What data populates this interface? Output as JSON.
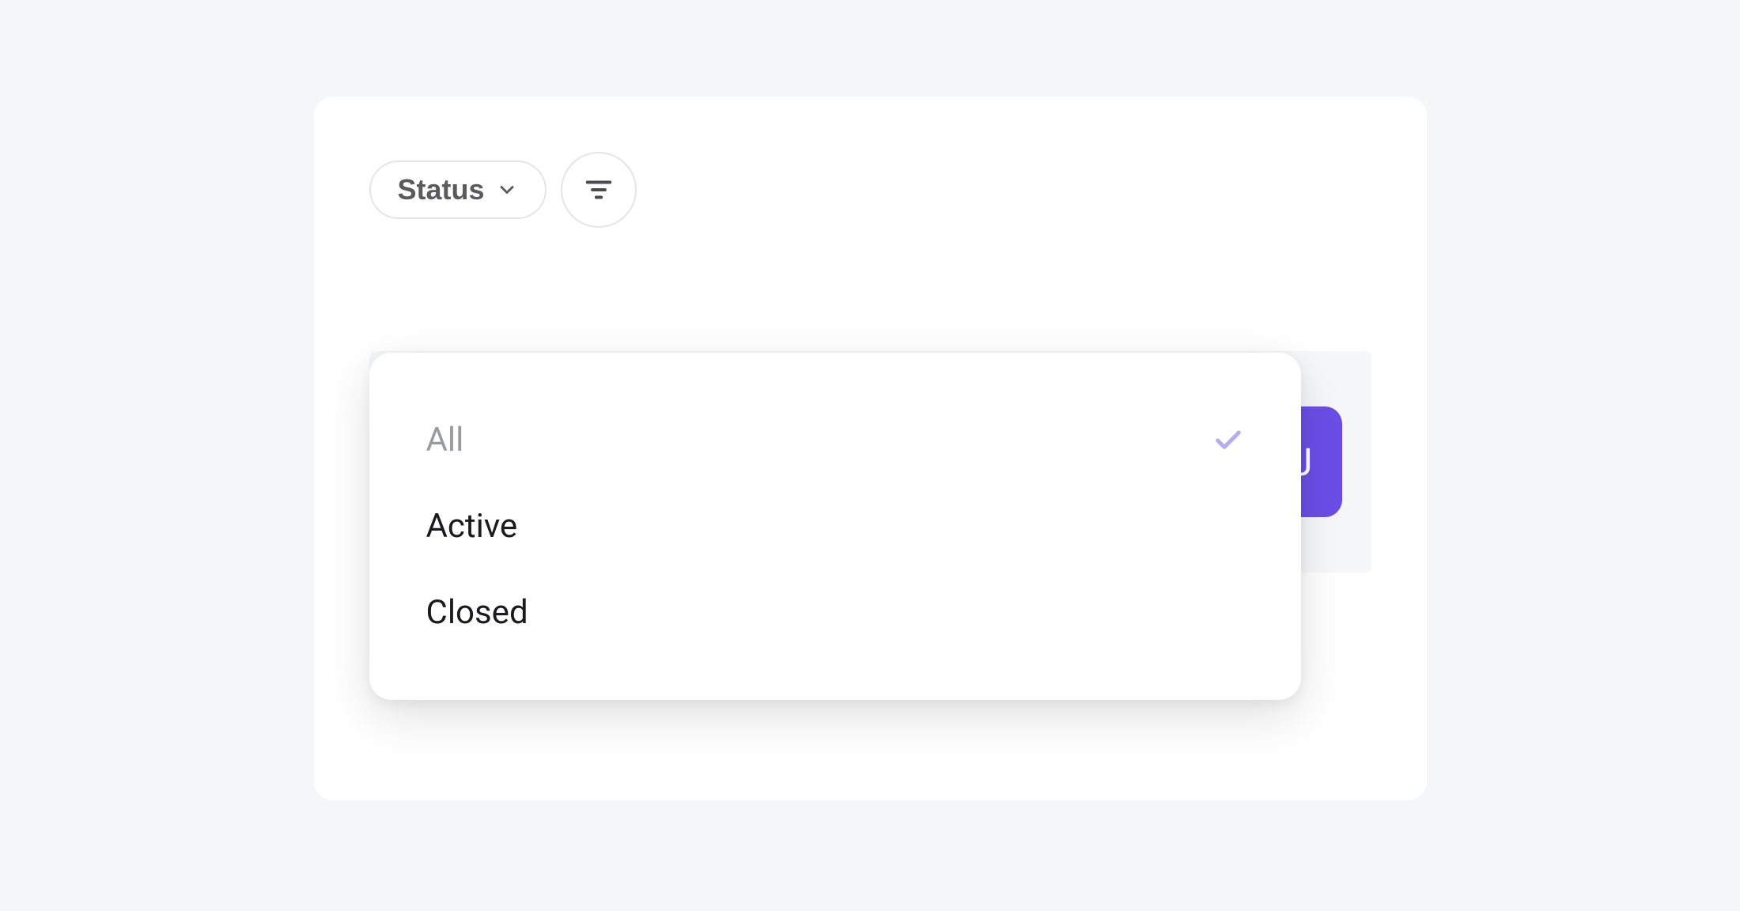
{
  "filter": {
    "status_label": "Status",
    "options": [
      {
        "label": "All",
        "selected": true
      },
      {
        "label": "Active",
        "selected": false
      },
      {
        "label": "Closed",
        "selected": false
      }
    ]
  },
  "badge": {
    "letter": "J"
  },
  "colors": {
    "accent": "#6b4ee6",
    "check": "#b8aaf0"
  }
}
